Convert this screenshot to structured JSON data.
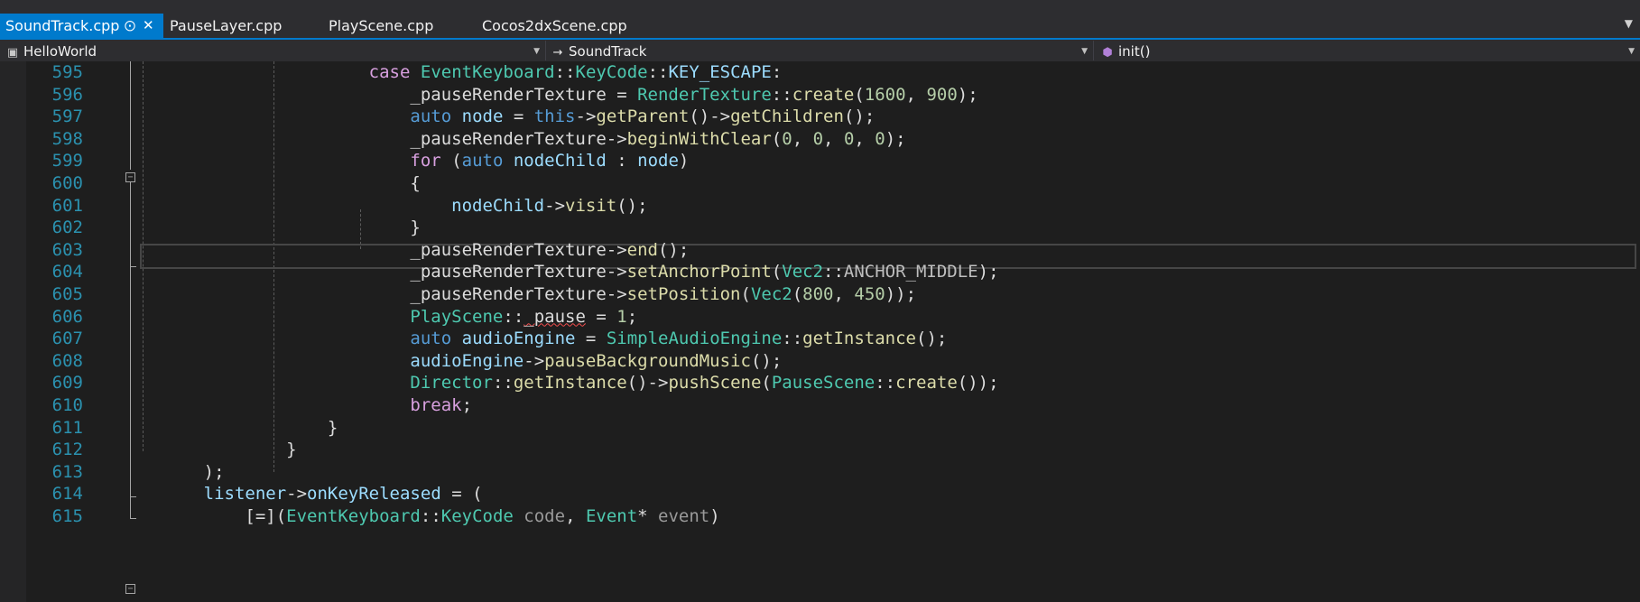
{
  "tabs": [
    {
      "label": "SoundTrack.cpp",
      "active": true,
      "pinned": true
    },
    {
      "label": "PauseLayer.cpp",
      "active": false
    },
    {
      "label": "PlayScene.cpp",
      "active": false
    },
    {
      "label": "Cocos2dxScene.cpp",
      "active": false
    }
  ],
  "tab_icons": {
    "pin": "pin-icon",
    "close": "close-icon",
    "dropdown": "chevron-down-icon"
  },
  "navbar": {
    "project": "HelloWorld",
    "project_icon": "project-icon",
    "scope": "SoundTrack",
    "scope_icon": "arrow-right-icon",
    "member": "init()",
    "member_icon": "method-cube-icon"
  },
  "colors": {
    "accent": "#007acc",
    "background": "#1e1e1e",
    "line_number": "#2b91af",
    "keyword": "#569cd6",
    "control_keyword": "#d8a0df",
    "type": "#4ec9b0",
    "function": "#dcdcaa",
    "number": "#b5cea8",
    "variable": "#9cdcfe"
  },
  "editor": {
    "current_line": "602",
    "lines": [
      {
        "num": "595",
        "tokens": [
          [
            "kw2",
            "                      "
          ],
          [
            "ctl",
            "case"
          ],
          [
            "",
            " "
          ],
          [
            "ty",
            "EventKeyboard"
          ],
          [
            "",
            "::"
          ],
          [
            "ty",
            "KeyCode"
          ],
          [
            "",
            "::"
          ],
          [
            "var",
            "KEY_ESCAPE"
          ],
          [
            "",
            ":"
          ]
        ]
      },
      {
        "num": "596",
        "tokens": [
          [
            "",
            "                          _pauseRenderTexture = "
          ],
          [
            "ty",
            "RenderTexture"
          ],
          [
            "",
            "::"
          ],
          [
            "fn",
            "create"
          ],
          [
            "",
            "("
          ],
          [
            "num",
            "1600"
          ],
          [
            "",
            ", "
          ],
          [
            "num",
            "900"
          ],
          [
            "",
            ");"
          ]
        ]
      },
      {
        "num": "597",
        "tokens": [
          [
            "",
            "                          "
          ],
          [
            "kw",
            "auto"
          ],
          [
            "",
            " "
          ],
          [
            "var",
            "node"
          ],
          [
            "",
            " = "
          ],
          [
            "kw",
            "this"
          ],
          [
            "",
            "->"
          ],
          [
            "fn",
            "getParent"
          ],
          [
            "",
            "()->"
          ],
          [
            "fn",
            "getChildren"
          ],
          [
            "",
            "();"
          ]
        ]
      },
      {
        "num": "598",
        "tokens": [
          [
            "",
            "                          _pauseRenderTexture->"
          ],
          [
            "fn",
            "beginWithClear"
          ],
          [
            "",
            "("
          ],
          [
            "num",
            "0"
          ],
          [
            "",
            ", "
          ],
          [
            "num",
            "0"
          ],
          [
            "",
            ", "
          ],
          [
            "num",
            "0"
          ],
          [
            "",
            ", "
          ],
          [
            "num",
            "0"
          ],
          [
            "",
            ");"
          ]
        ]
      },
      {
        "num": "599",
        "tokens": [
          [
            "",
            "                          "
          ],
          [
            "ctl",
            "for"
          ],
          [
            "",
            " ("
          ],
          [
            "kw",
            "auto"
          ],
          [
            "",
            " "
          ],
          [
            "var",
            "nodeChild"
          ],
          [
            "",
            " : "
          ],
          [
            "var",
            "node"
          ],
          [
            "",
            ")"
          ]
        ]
      },
      {
        "num": "600",
        "tokens": [
          [
            "",
            "                          {"
          ]
        ]
      },
      {
        "num": "601",
        "tokens": [
          [
            "",
            "                              "
          ],
          [
            "var",
            "nodeChild"
          ],
          [
            "",
            "->"
          ],
          [
            "fn",
            "visit"
          ],
          [
            "",
            "();"
          ]
        ]
      },
      {
        "num": "602",
        "tokens": [
          [
            "",
            "                          }"
          ]
        ]
      },
      {
        "num": "603",
        "tokens": [
          [
            "",
            "                          _pauseRenderTexture->"
          ],
          [
            "fn",
            "end"
          ],
          [
            "",
            "();"
          ]
        ]
      },
      {
        "num": "604",
        "tokens": [
          [
            "",
            "                          _pauseRenderTexture->"
          ],
          [
            "fn",
            "setAnchorPoint"
          ],
          [
            "",
            "("
          ],
          [
            "ty",
            "Vec2"
          ],
          [
            "",
            "::"
          ],
          [
            "mac",
            "ANCHOR_MIDDLE"
          ],
          [
            "",
            ");"
          ]
        ]
      },
      {
        "num": "605",
        "tokens": [
          [
            "",
            "                          _pauseRenderTexture->"
          ],
          [
            "fn",
            "setPosition"
          ],
          [
            "",
            "("
          ],
          [
            "ty",
            "Vec2"
          ],
          [
            "",
            "("
          ],
          [
            "num",
            "800"
          ],
          [
            "",
            ", "
          ],
          [
            "num",
            "450"
          ],
          [
            "",
            "));"
          ]
        ]
      },
      {
        "num": "606",
        "tokens": [
          [
            "",
            "                          "
          ],
          [
            "ty",
            "PlayScene"
          ],
          [
            "",
            "::"
          ],
          [
            "squig",
            "_pause"
          ],
          [
            "",
            " = "
          ],
          [
            "num",
            "1"
          ],
          [
            "",
            ";"
          ]
        ]
      },
      {
        "num": "607",
        "tokens": [
          [
            "",
            "                          "
          ],
          [
            "kw",
            "auto"
          ],
          [
            "",
            " "
          ],
          [
            "var",
            "audioEngine"
          ],
          [
            "",
            " = "
          ],
          [
            "ty",
            "SimpleAudioEngine"
          ],
          [
            "",
            "::"
          ],
          [
            "fn",
            "getInstance"
          ],
          [
            "",
            "();"
          ]
        ]
      },
      {
        "num": "608",
        "tokens": [
          [
            "",
            "                          "
          ],
          [
            "var",
            "audioEngine"
          ],
          [
            "",
            "->"
          ],
          [
            "fn",
            "pauseBackgroundMusic"
          ],
          [
            "",
            "();"
          ]
        ]
      },
      {
        "num": "609",
        "tokens": [
          [
            "",
            "                          "
          ],
          [
            "ty",
            "Director"
          ],
          [
            "",
            "::"
          ],
          [
            "fn",
            "getInstance"
          ],
          [
            "",
            "()->"
          ],
          [
            "fn",
            "pushScene"
          ],
          [
            "",
            "("
          ],
          [
            "ty",
            "PauseScene"
          ],
          [
            "",
            "::"
          ],
          [
            "fn",
            "create"
          ],
          [
            "",
            "());"
          ]
        ]
      },
      {
        "num": "610",
        "tokens": [
          [
            "",
            "                          "
          ],
          [
            "ctl",
            "break"
          ],
          [
            "",
            ";"
          ]
        ]
      },
      {
        "num": "611",
        "tokens": [
          [
            "",
            "                  }"
          ]
        ]
      },
      {
        "num": "612",
        "tokens": [
          [
            "",
            "              }"
          ]
        ]
      },
      {
        "num": "613",
        "tokens": [
          [
            "",
            "      );"
          ]
        ]
      },
      {
        "num": "614",
        "tokens": [
          [
            "",
            "      "
          ],
          [
            "var",
            "listener"
          ],
          [
            "",
            "->"
          ],
          [
            "var",
            "onKeyReleased"
          ],
          [
            "",
            " = ("
          ]
        ]
      },
      {
        "num": "615",
        "tokens": [
          [
            "",
            "          [=]("
          ],
          [
            "ty",
            "EventKeyboard"
          ],
          [
            "",
            "::"
          ],
          [
            "ty",
            "KeyCode"
          ],
          [
            "",
            " "
          ],
          [
            "par",
            "code"
          ],
          [
            "",
            ", "
          ],
          [
            "ty",
            "Event"
          ],
          [
            "",
            "* "
          ],
          [
            "par",
            "event"
          ],
          [
            "",
            ")"
          ]
        ]
      }
    ]
  }
}
